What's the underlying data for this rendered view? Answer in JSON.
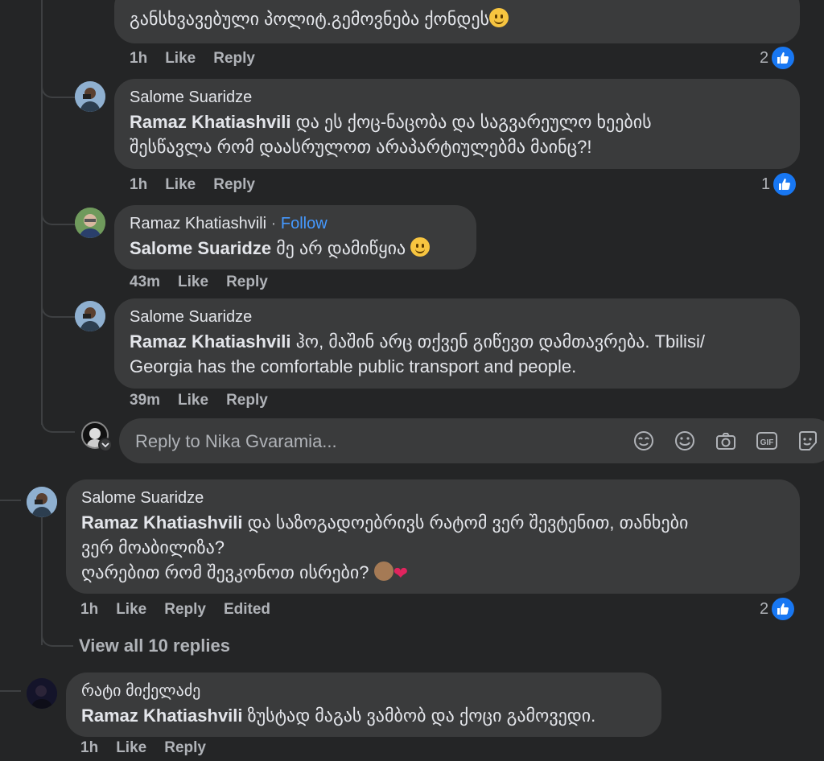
{
  "comments": [
    {
      "text_line1": "განსხვავებული პოლიტ.გემოვნება ქონდეს",
      "actions": {
        "time": "1h",
        "like": "Like",
        "reply": "Reply"
      },
      "reactions": "2"
    },
    {
      "author": "Salome Suaridze",
      "mention": "Ramaz Khatiashvili",
      "text": " და ეს ქოც-ნაცობა და საგვარეულო ხეების",
      "text_line2": "შესწავლა რომ დაასრულოთ არაპარტიულებმა მაინც?!",
      "actions": {
        "time": "1h",
        "like": "Like",
        "reply": "Reply"
      },
      "reactions": "1"
    },
    {
      "author": "Ramaz Khatiashvili",
      "follow": "Follow",
      "mention": "Salome Suaridze",
      "text": " მე არ დამიწყია ",
      "actions": {
        "time": "43m",
        "like": "Like",
        "reply": "Reply"
      }
    },
    {
      "author": "Salome Suaridze",
      "mention": "Ramaz Khatiashvili",
      "text": " ჰო, მაშინ არც თქვენ გიწევთ დამთავრება. Tbilisi/",
      "text_line2": "Georgia has the comfortable public transport and people.",
      "actions": {
        "time": "39m",
        "like": "Like",
        "reply": "Reply"
      }
    },
    {
      "author": "Salome Suaridze",
      "mention": "Ramaz Khatiashvili",
      "text": " და საზოგადოებრივს რატომ ვერ შევტენით, თანხები",
      "text_line2": "ვერ მოაბილიზა?",
      "text_line3": "ღარებით რომ შევკონოთ ისრები? ",
      "actions": {
        "time": "1h",
        "like": "Like",
        "reply": "Reply",
        "edited": "Edited"
      },
      "reactions": "2"
    },
    {
      "author": "რატი მიქელაძე",
      "mention": "Ramaz Khatiashvili",
      "text": " ზუსტად მაგას ვამბობ და ქოცი გამოვედი.",
      "actions": {
        "time": "1h",
        "like": "Like",
        "reply": "Reply"
      }
    }
  ],
  "reply_box": {
    "placeholder": "Reply to Nika Gvaramia..."
  },
  "view_all": "View all 10 replies",
  "icons": [
    "avatar-sticker-icon",
    "emoji-icon",
    "camera-icon",
    "gif-icon",
    "sticker-icon",
    "like-icon"
  ],
  "colors": {
    "background": "#242526",
    "bubble": "#3a3b3c",
    "link": "#4599ff",
    "like_badge": "#1877f2",
    "muted": "#b0b3b8"
  }
}
